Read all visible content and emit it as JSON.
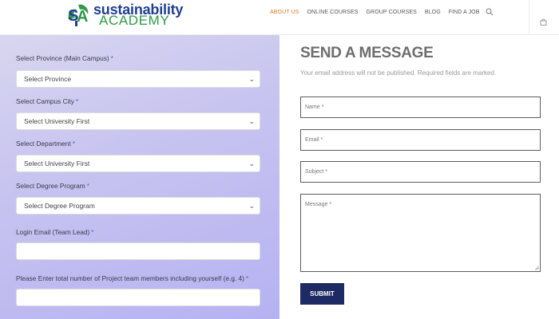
{
  "brand": {
    "logo_line1": "sustainability",
    "logo_line2": "ACADEMY",
    "logo_mark": "SA",
    "colors": {
      "blue": "#1f3f8f",
      "green": "#2f9a4a"
    }
  },
  "nav": {
    "items": [
      {
        "label": "ABOUT US",
        "active": true
      },
      {
        "label": "ONLINE COURSES",
        "active": false
      },
      {
        "label": "GROUP COURSES",
        "active": false
      },
      {
        "label": "BLOG",
        "active": false
      },
      {
        "label": "FIND A JOB",
        "active": false
      }
    ],
    "search_icon": "search-icon",
    "cart_icon": "bag-icon",
    "active_color": "#e07b2a"
  },
  "left_form": {
    "province": {
      "label": "Select Province (Main Campus)",
      "required": "*",
      "value": "Select Province"
    },
    "campus_city": {
      "label": "Select Campus City",
      "required": "*",
      "value": "Select University First"
    },
    "department": {
      "label": "Select Department",
      "required": "*",
      "value": "Select University First"
    },
    "degree_program": {
      "label": "Select Degree Program",
      "required": "*",
      "value": "Select Degree Program"
    },
    "login_email": {
      "label": "Login Email (Team Lead)",
      "required": "*",
      "value": ""
    },
    "team_members": {
      "label": "Please Enter total number of Project team members including yourself (e.g. 4)",
      "required": "*",
      "value": ""
    }
  },
  "message_form": {
    "title": "SEND A MESSAGE",
    "note": "Your email address will not be published. Required fields are marked.",
    "name_placeholder": "Name *",
    "email_placeholder": "Email *",
    "subject_placeholder": "Subject *",
    "message_placeholder": "Message *",
    "submit_label": "SUBMIT",
    "submit_color": "#1d2a63"
  }
}
